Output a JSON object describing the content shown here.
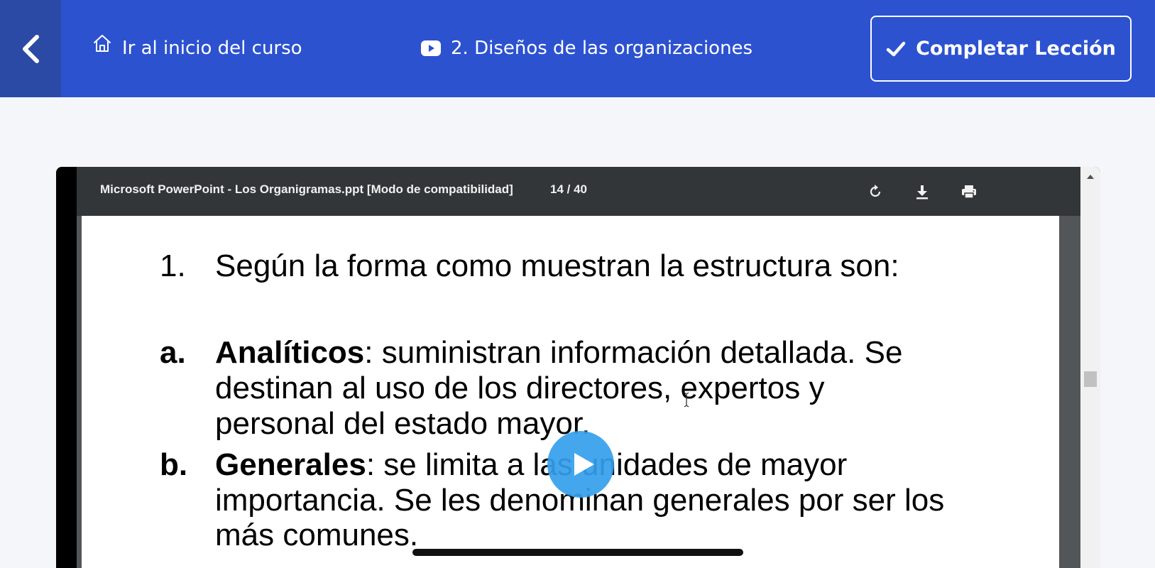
{
  "topbar": {
    "home_link_label": "Ir al inicio del curso",
    "lesson_title": "2. Diseños de las organizaciones",
    "complete_button_label": "Completar Lección",
    "background_color": "#2c52d0",
    "back_button_color": "#2a4aa6"
  },
  "icons": {
    "back": "chevron-left-icon",
    "home": "home-icon",
    "video": "youtube-play-icon",
    "complete": "checkmark-icon",
    "rotate": "rotate-icon",
    "download": "download-icon",
    "print": "print-icon",
    "play": "play-icon"
  },
  "video": {
    "pdf_viewer": {
      "title": "Microsoft PowerPoint - Los Organigramas.ppt [Modo de compatibilidad]",
      "page_indicator": "14 / 40"
    },
    "slide": {
      "heading_number": "1.",
      "heading_text": "Según la forma como muestran la estructura son:",
      "items": [
        {
          "marker": "a.",
          "term": "Analíticos",
          "line1": ": suministran información detallada. Se",
          "line2": "destinan al uso de los directores, expertos y",
          "line3": "personal del estado mayor."
        },
        {
          "marker": "b.",
          "term": "Generales",
          "line1": ": se limita a las unidades de mayor",
          "line2": "importancia. Se les denominan generales por ser los",
          "line3": "más comunes."
        }
      ]
    },
    "play_button_color": "#34a0ec"
  }
}
